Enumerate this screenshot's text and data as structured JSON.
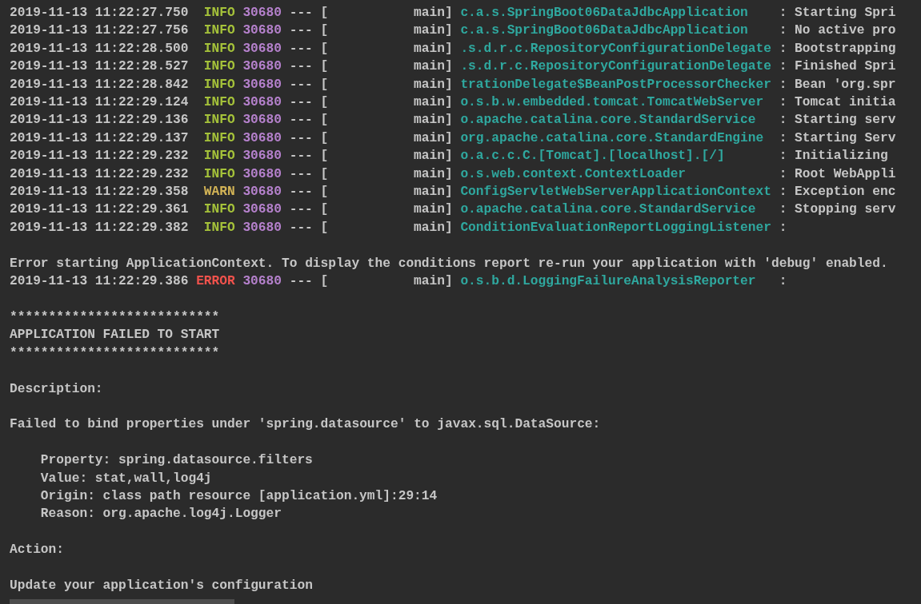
{
  "console": {
    "lines": [
      {
        "kind": "log",
        "time": "2019-11-13 11:22:27.750",
        "level": "INFO",
        "color": "#a5c23a",
        "pid": "30680",
        "separator": "--- [",
        "thread": "main]",
        "logger": "c.a.s.SpringBoot06DataJdbcApplication",
        "message": ": Starting Spri"
      },
      {
        "kind": "log",
        "time": "2019-11-13 11:22:27.756",
        "level": "INFO",
        "color": "#a5c23a",
        "pid": "30680",
        "separator": "--- [",
        "thread": "main]",
        "logger": "c.a.s.SpringBoot06DataJdbcApplication",
        "message": ": No active pro"
      },
      {
        "kind": "log",
        "time": "2019-11-13 11:22:28.500",
        "level": "INFO",
        "color": "#a5c23a",
        "pid": "30680",
        "separator": "--- [",
        "thread": "main]",
        "logger": ".s.d.r.c.RepositoryConfigurationDelegate",
        "message": ": Bootstrapping"
      },
      {
        "kind": "log",
        "time": "2019-11-13 11:22:28.527",
        "level": "INFO",
        "color": "#a5c23a",
        "pid": "30680",
        "separator": "--- [",
        "thread": "main]",
        "logger": ".s.d.r.c.RepositoryConfigurationDelegate",
        "message": ": Finished Spri"
      },
      {
        "kind": "log",
        "time": "2019-11-13 11:22:28.842",
        "level": "INFO",
        "color": "#a5c23a",
        "pid": "30680",
        "separator": "--- [",
        "thread": "main]",
        "logger": "trationDelegate$BeanPostProcessorChecker",
        "message": ": Bean 'org.spr"
      },
      {
        "kind": "log",
        "time": "2019-11-13 11:22:29.124",
        "level": "INFO",
        "color": "#a5c23a",
        "pid": "30680",
        "separator": "--- [",
        "thread": "main]",
        "logger": "o.s.b.w.embedded.tomcat.TomcatWebServer",
        "message": ": Tomcat initia"
      },
      {
        "kind": "log",
        "time": "2019-11-13 11:22:29.136",
        "level": "INFO",
        "color": "#a5c23a",
        "pid": "30680",
        "separator": "--- [",
        "thread": "main]",
        "logger": "o.apache.catalina.core.StandardService",
        "message": ": Starting serv"
      },
      {
        "kind": "log",
        "time": "2019-11-13 11:22:29.137",
        "level": "INFO",
        "color": "#a5c23a",
        "pid": "30680",
        "separator": "--- [",
        "thread": "main]",
        "logger": "org.apache.catalina.core.StandardEngine",
        "message": ": Starting Serv"
      },
      {
        "kind": "log",
        "time": "2019-11-13 11:22:29.232",
        "level": "INFO",
        "color": "#a5c23a",
        "pid": "30680",
        "separator": "--- [",
        "thread": "main]",
        "logger": "o.a.c.c.C.[Tomcat].[localhost].[/]",
        "message": ": Initializing"
      },
      {
        "kind": "log",
        "time": "2019-11-13 11:22:29.232",
        "level": "INFO",
        "color": "#a5c23a",
        "pid": "30680",
        "separator": "--- [",
        "thread": "main]",
        "logger": "o.s.web.context.ContextLoader",
        "message": ": Root WebAppli"
      },
      {
        "kind": "log",
        "time": "2019-11-13 11:22:29.358",
        "level": "WARN",
        "color": "#d2b356",
        "pid": "30680",
        "separator": "--- [",
        "thread": "main]",
        "logger": "ConfigServletWebServerApplicationContext",
        "message": ": Exception enc"
      },
      {
        "kind": "log",
        "time": "2019-11-13 11:22:29.361",
        "level": "INFO",
        "color": "#a5c23a",
        "pid": "30680",
        "separator": "--- [",
        "thread": "main]",
        "logger": "o.apache.catalina.core.StandardService",
        "message": ": Stopping serv"
      },
      {
        "kind": "log",
        "time": "2019-11-13 11:22:29.382",
        "level": "INFO",
        "color": "#a5c23a",
        "pid": "30680",
        "separator": "--- [",
        "thread": "main]",
        "logger": "ConditionEvaluationReportLoggingListener",
        "message": ":"
      },
      {
        "kind": "blank"
      },
      {
        "kind": "text",
        "text": "Error starting ApplicationContext. To display the conditions report re-run your application with 'debug' enabled."
      },
      {
        "kind": "log",
        "time": "2019-11-13 11:22:29.386",
        "level": "ERROR",
        "color": "#f0524c",
        "pid": "30680",
        "separator": "--- [",
        "thread": "main]",
        "logger": "o.s.b.d.LoggingFailureAnalysisReporter",
        "message": ":"
      },
      {
        "kind": "blank"
      },
      {
        "kind": "text",
        "text": "***************************"
      },
      {
        "kind": "text",
        "text": "APPLICATION FAILED TO START"
      },
      {
        "kind": "text",
        "text": "***************************"
      },
      {
        "kind": "blank"
      },
      {
        "kind": "text",
        "text": "Description:"
      },
      {
        "kind": "blank"
      },
      {
        "kind": "text",
        "text": "Failed to bind properties under 'spring.datasource' to javax.sql.DataSource:"
      },
      {
        "kind": "blank"
      },
      {
        "kind": "indented",
        "text": "Property: spring.datasource.filters"
      },
      {
        "kind": "indented",
        "text": "Value: stat,wall,log4j"
      },
      {
        "kind": "indented",
        "text": "Origin: class path resource [application.yml]:29:14"
      },
      {
        "kind": "indented",
        "text": "Reason: org.apache.log4j.Logger"
      },
      {
        "kind": "blank"
      },
      {
        "kind": "text",
        "text": "Action:"
      },
      {
        "kind": "blank"
      },
      {
        "kind": "text",
        "text": "Update your application's configuration"
      }
    ]
  }
}
